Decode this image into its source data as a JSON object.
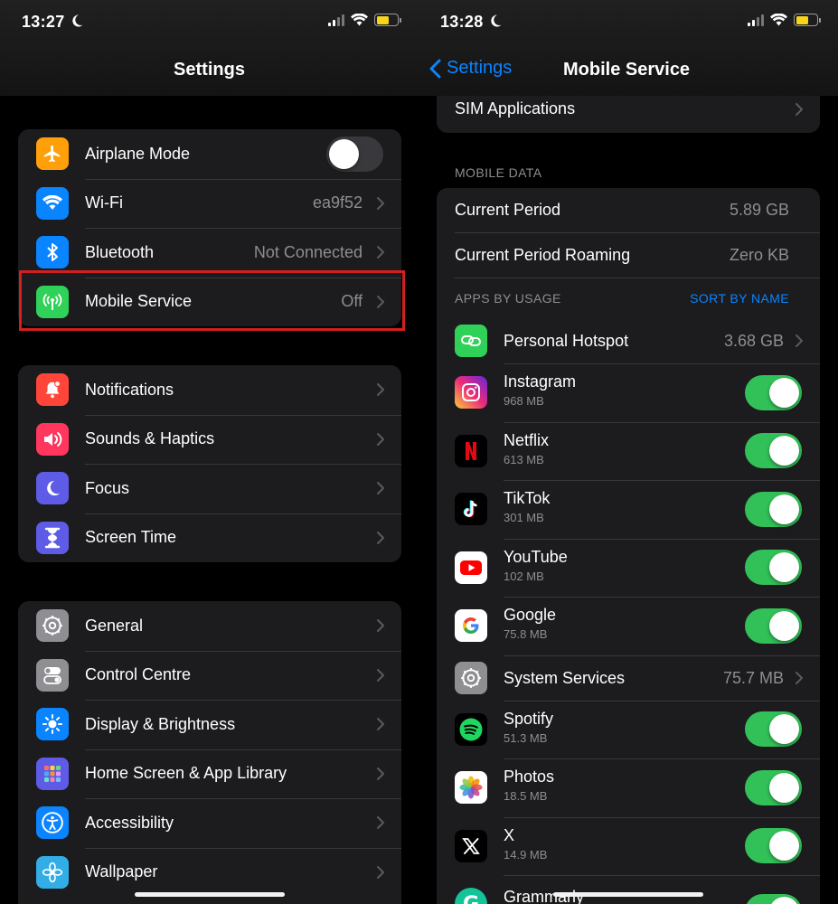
{
  "left": {
    "status": {
      "time": "13:27"
    },
    "title": "Settings",
    "groups": [
      [
        {
          "label": "Airplane Mode",
          "value": "",
          "icon": "airplane-icon",
          "color": "#ff9f0a",
          "toggle": "off"
        },
        {
          "label": "Wi-Fi",
          "value": "ea9f52",
          "icon": "wifi-icon",
          "color": "#0a84ff"
        },
        {
          "label": "Bluetooth",
          "value": "Not Connected",
          "icon": "bluetooth-icon",
          "color": "#0a84ff"
        },
        {
          "label": "Mobile Service",
          "value": "Off",
          "icon": "antenna-icon",
          "color": "#30d158"
        }
      ],
      [
        {
          "label": "Notifications",
          "icon": "bell-icon",
          "color": "#ff453a"
        },
        {
          "label": "Sounds & Haptics",
          "icon": "speaker-icon",
          "color": "#ff375f"
        },
        {
          "label": "Focus",
          "icon": "moon-icon",
          "color": "#5e5ce6"
        },
        {
          "label": "Screen Time",
          "icon": "hourglass-icon",
          "color": "#5e5ce6"
        }
      ],
      [
        {
          "label": "General",
          "icon": "gear-icon",
          "color": "#8e8e93"
        },
        {
          "label": "Control Centre",
          "icon": "switches-icon",
          "color": "#8e8e93"
        },
        {
          "label": "Display & Brightness",
          "icon": "sun-icon",
          "color": "#0a84ff"
        },
        {
          "label": "Home Screen & App Library",
          "icon": "grid-icon",
          "color": "#5e5ce6"
        },
        {
          "label": "Accessibility",
          "icon": "accessibility-icon",
          "color": "#0a84ff"
        },
        {
          "label": "Wallpaper",
          "icon": "flower-icon",
          "color": "#32ade6"
        }
      ]
    ]
  },
  "right": {
    "status": {
      "time": "13:28"
    },
    "back_label": "Settings",
    "title": "Mobile Service",
    "sim_applications": "SIM Applications",
    "mobile_data_header": "MOBILE DATA",
    "current_period_label": "Current Period",
    "current_period_value": "5.89 GB",
    "roaming_label": "Current Period Roaming",
    "roaming_value": "Zero KB",
    "apps_header": "APPS BY USAGE",
    "sort_label": "SORT BY NAME",
    "apps": [
      {
        "name": "Personal Hotspot",
        "size": "",
        "value": "3.68 GB",
        "icon": "hotspot-icon",
        "kind": "chevron"
      },
      {
        "name": "Instagram",
        "size": "968 MB",
        "icon": "instagram-icon",
        "kind": "toggle"
      },
      {
        "name": "Netflix",
        "size": "613 MB",
        "icon": "netflix-icon",
        "kind": "toggle"
      },
      {
        "name": "TikTok",
        "size": "301 MB",
        "icon": "tiktok-icon",
        "kind": "toggle"
      },
      {
        "name": "YouTube",
        "size": "102 MB",
        "icon": "youtube-icon",
        "kind": "toggle"
      },
      {
        "name": "Google",
        "size": "75.8 MB",
        "icon": "google-icon",
        "kind": "toggle"
      },
      {
        "name": "System Services",
        "size": "",
        "value": "75.7 MB",
        "icon": "gear-icon",
        "kind": "chevron"
      },
      {
        "name": "Spotify",
        "size": "51.3 MB",
        "icon": "spotify-icon",
        "kind": "toggle"
      },
      {
        "name": "Photos",
        "size": "18.5 MB",
        "icon": "photos-icon",
        "kind": "toggle"
      },
      {
        "name": "X",
        "size": "14.9 MB",
        "icon": "x-icon",
        "kind": "toggle"
      },
      {
        "name": "Grammarly",
        "size": "",
        "icon": "grammarly-icon",
        "kind": "toggle"
      }
    ]
  }
}
